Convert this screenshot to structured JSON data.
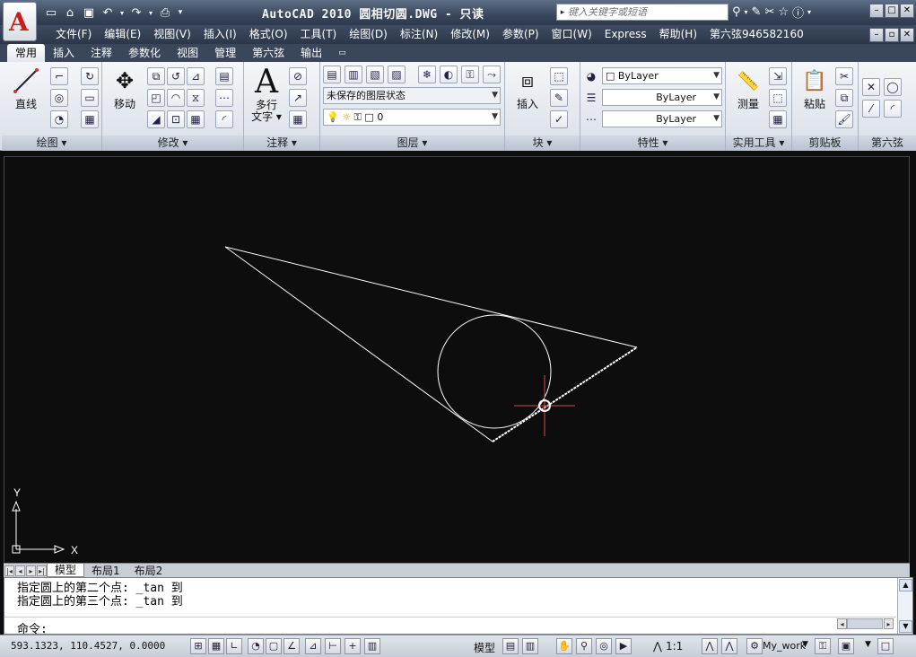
{
  "app": {
    "title": "AutoCAD 2010   圆相切圆.DWG - 只读",
    "search_placeholder": "键入关键字或短语"
  },
  "menus": [
    "文件(F)",
    "编辑(E)",
    "视图(V)",
    "插入(I)",
    "格式(O)",
    "工具(T)",
    "绘图(D)",
    "标注(N)",
    "修改(M)",
    "参数(P)",
    "窗口(W)",
    "Express",
    "帮助(H)",
    "第六弦946582160"
  ],
  "tabs": [
    "常用",
    "插入",
    "注释",
    "参数化",
    "视图",
    "管理",
    "第六弦",
    "输出"
  ],
  "active_tab": "常用",
  "ribbon": {
    "draw": {
      "title": "绘图",
      "line_label": "直线"
    },
    "modify": {
      "title": "修改",
      "move_label": "移动"
    },
    "annotation": {
      "title": "注释",
      "mtext_label": "多行\n文字"
    },
    "layers": {
      "title": "图层",
      "state_combo": "未保存的图层状态",
      "layer_combo": "0"
    },
    "block": {
      "title": "块",
      "insert_label": "插入"
    },
    "properties": {
      "title": "特性",
      "color": "ByLayer",
      "linetype": "ByLayer",
      "lineweight": "ByLayer"
    },
    "utilities": {
      "title": "实用工具",
      "measure_label": "测量"
    },
    "clipboard": {
      "title": "剪贴板",
      "paste_label": "粘贴"
    },
    "sixth": {
      "title": "第六弦"
    }
  },
  "canvas": {
    "ucs_x": "X",
    "ucs_y": "Y"
  },
  "layout_tabs": [
    "模型",
    "布局1",
    "布局2"
  ],
  "command": {
    "history": [
      "指定圆上的第二个点: _tan 到",
      "指定圆上的第三个点: _tan 到"
    ],
    "prompt": "命令:"
  },
  "status": {
    "coords": "593.1323, 110.4527, 0.0000",
    "model_label": "模型",
    "scale_label": "1:1",
    "workspace": "My_work"
  },
  "colors": {
    "canvas_bg": "#0d0d0d",
    "geometry": "#ffffff",
    "crosshair": "#d9484a",
    "title_bar": "#3a475c"
  }
}
